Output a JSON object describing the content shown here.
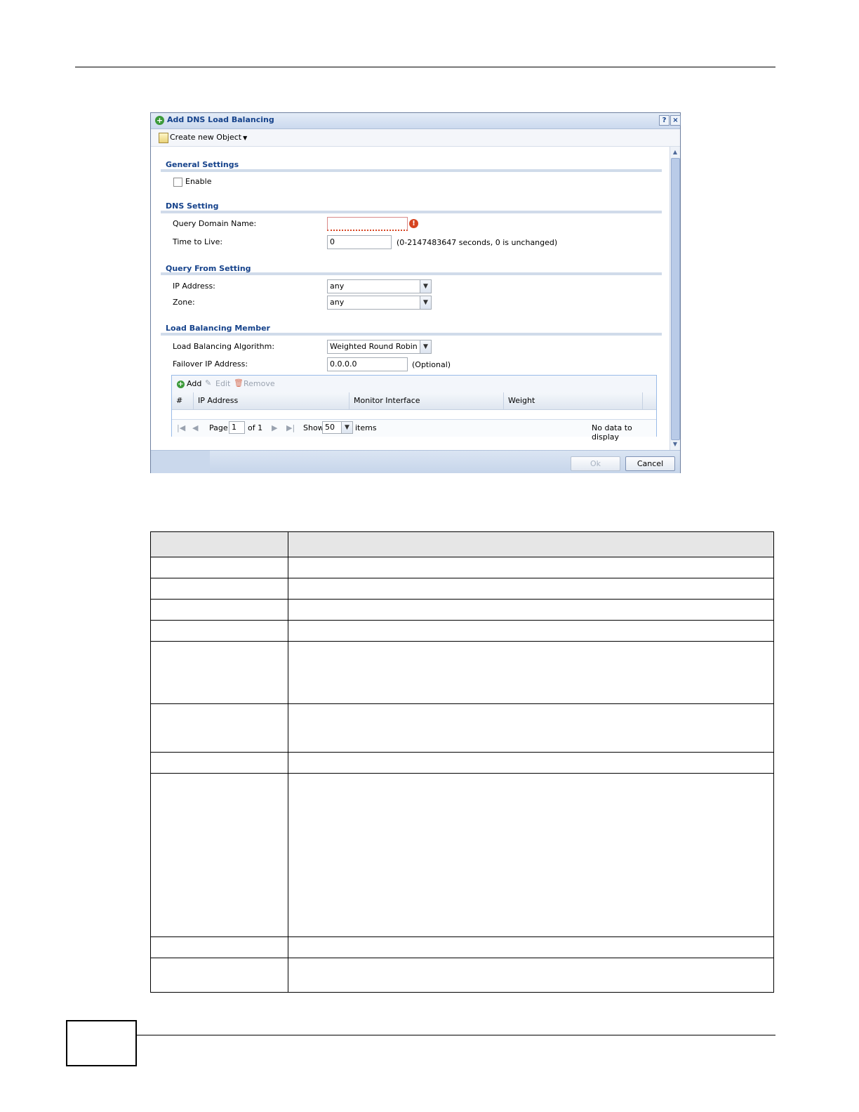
{
  "dialog": {
    "title": "Add DNS Load Balancing",
    "help_label": "?",
    "close_label": "×",
    "toolbar": {
      "create_label": "Create new Object"
    }
  },
  "general": {
    "heading": "General Settings",
    "enable_label": "Enable"
  },
  "dns": {
    "heading": "DNS Setting",
    "query_domain_label": "Query Domain Name:",
    "query_domain_value": "",
    "ttl_label": "Time to Live:",
    "ttl_value": "0",
    "ttl_hint": "(0-2147483647 seconds, 0 is unchanged)"
  },
  "query_from": {
    "heading": "Query From Setting",
    "ip_label": "IP Address:",
    "ip_value": "any",
    "zone_label": "Zone:",
    "zone_value": "any"
  },
  "member": {
    "heading": "Load Balancing Member",
    "algorithm_label": "Load Balancing Algorithm:",
    "algorithm_value": "Weighted Round Robin",
    "failover_label": "Failover IP Address:",
    "failover_value": "0.0.0.0",
    "failover_hint": "(Optional)",
    "grid": {
      "add_label": "Add",
      "edit_label": "Edit",
      "remove_label": "Remove",
      "columns": [
        "#",
        "IP Address",
        "Monitor Interface",
        "Weight"
      ],
      "pager": {
        "page_label": "Page",
        "page_value": "1",
        "of_label": "of 1",
        "show_label": "Show",
        "show_value": "50",
        "items_label": "items",
        "empty_label": "No data to display"
      }
    }
  },
  "buttons": {
    "ok_label": "Ok",
    "cancel_label": "Cancel"
  }
}
